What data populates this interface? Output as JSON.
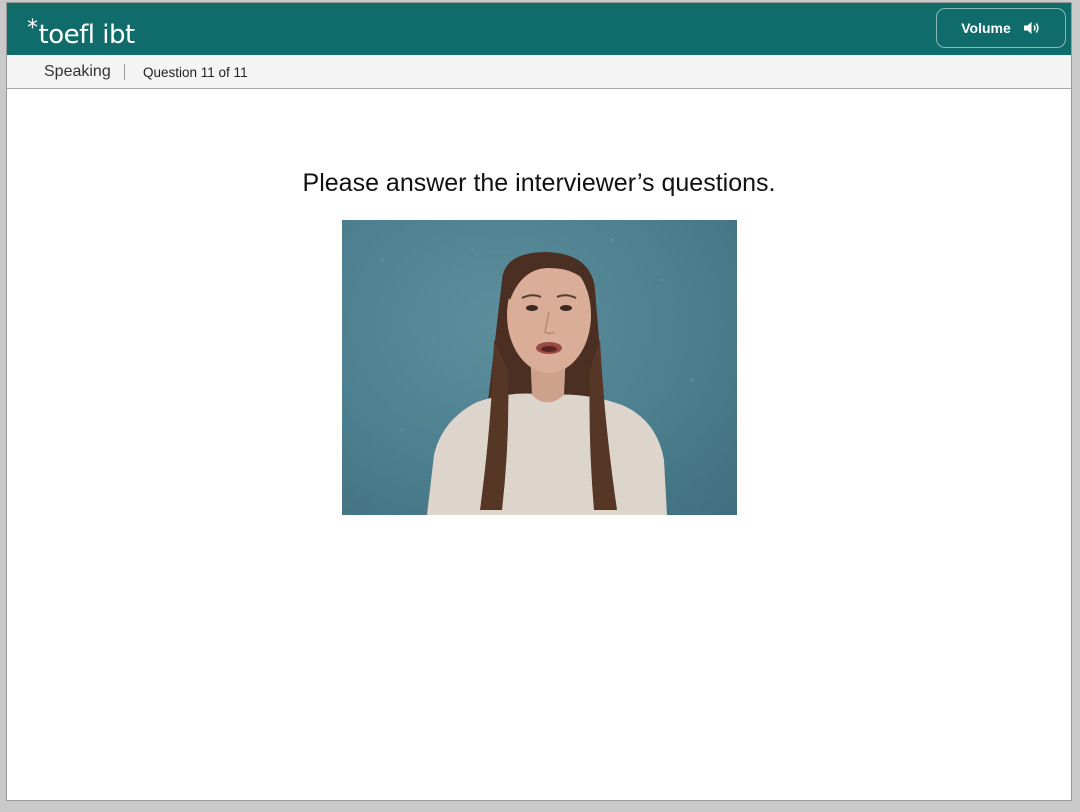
{
  "header": {
    "logo_star": "*",
    "logo_text": "toefl ibt",
    "volume_label": "Volume",
    "volume_icon": "speaker-icon",
    "brand_color": "#106b6b"
  },
  "subheader": {
    "section": "Speaking",
    "question_counter": "Question 11 of 11"
  },
  "main": {
    "instruction": "Please answer the interviewer’s questions."
  }
}
